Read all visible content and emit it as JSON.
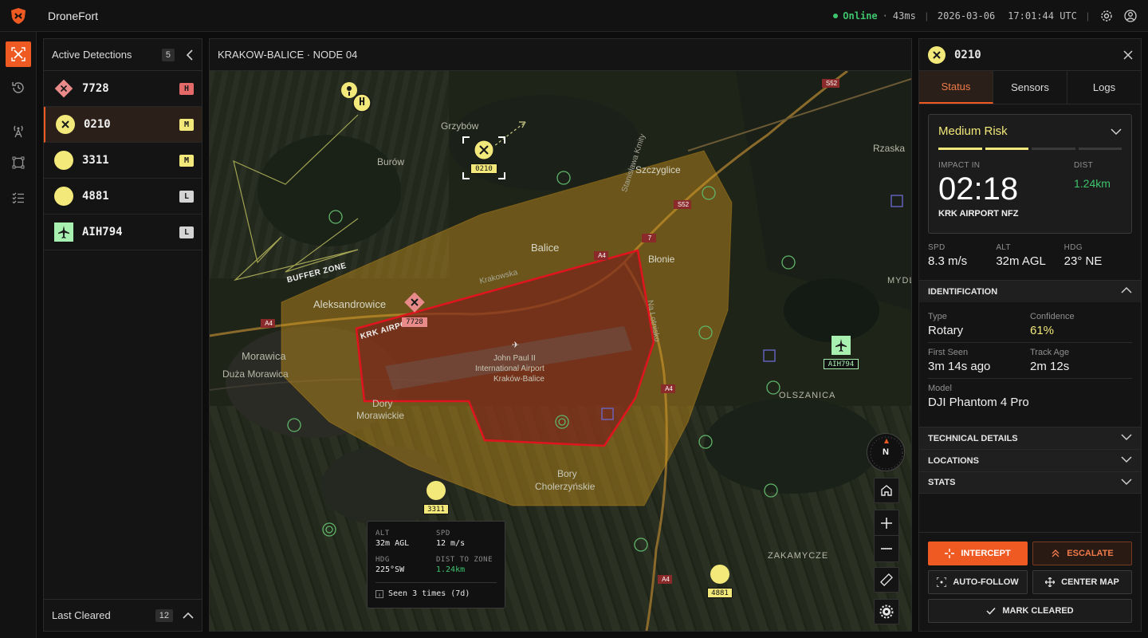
{
  "app": {
    "name": "DroneFort"
  },
  "status": {
    "connection": "Online",
    "latency": "43ms",
    "date": "2026-03-06",
    "time": "17:01:44 UTC"
  },
  "rail": {
    "icons": [
      "drone-target-icon",
      "history-icon",
      "radar-icon",
      "zone-icon",
      "checklist-icon"
    ]
  },
  "detections": {
    "title": "Active Detections",
    "count": "5",
    "items": [
      {
        "id": "7728",
        "risk": "H",
        "kind": "hostile"
      },
      {
        "id": "0210",
        "risk": "M",
        "kind": "unknown"
      },
      {
        "id": "3311",
        "risk": "M",
        "kind": "drone"
      },
      {
        "id": "4881",
        "risk": "L",
        "kind": "drone"
      },
      {
        "id": "AIH794",
        "risk": "L",
        "kind": "aircraft"
      }
    ],
    "footer_label": "Last Cleared",
    "footer_count": "12"
  },
  "map": {
    "title": "KRAKOW-BALICE · NODE 04",
    "labels": {
      "grzybow": "Grzybów",
      "burow": "Burów",
      "szczyglice": "Szczyglice",
      "rzaska": "Rzaska",
      "balice": "Balice",
      "btonie": "Błonie",
      "aleksandrowice": "Aleksandrowice",
      "morawica": "Morawica",
      "duza": "Duża Morawica",
      "dory": "Dory",
      "morawickie": "Morawickie",
      "olszanica": "OLSZANICA",
      "zakamycze": "ZAKAMYCZE",
      "mydl": "MYDL",
      "bory": "Bory",
      "cholerzynskie": "Cholerzyńskie",
      "airport1": "John Paul II",
      "airport2": "International Airport",
      "airport3": "Kraków-Balice",
      "krakowska": "Krakowska",
      "nalotnisko": "Na Lotnisko",
      "stanislawa": "Stanisława Kmity",
      "buffer": "BUFFER ZONE",
      "krkairport": "KRK AIRPORT",
      "a4a": "A4",
      "a4b": "A4",
      "a4c": "A4",
      "a4d": "A4",
      "r7": "7",
      "s52a": "S52",
      "s52b": "S52"
    },
    "markers": {
      "m7728": "7728",
      "m0210": "0210",
      "m3311": "3311",
      "m4881": "4881",
      "maih": "AIH794",
      "home": "H"
    },
    "compass": "N",
    "tooltip": {
      "alt_label": "ALT",
      "alt": "32m AGL",
      "spd_label": "SPD",
      "spd": "12 m/s",
      "hdg_label": "HDG",
      "hdg": "225°SW",
      "dist_label": "DIST TO ZONE",
      "dist": "1.24km",
      "seen": "Seen 3 times (7d)"
    }
  },
  "detail": {
    "id": "0210",
    "tabs": [
      "Status",
      "Sensors",
      "Logs"
    ],
    "risk": {
      "label": "Medium Risk",
      "level": 2,
      "of": 4,
      "impact_label": "IMPACT IN",
      "impact": "02:18",
      "dist_label": "DIST",
      "dist": "1.24km",
      "zone": "KRK AIRPORT NFZ"
    },
    "spd": {
      "label": "SPD",
      "value": "8.3 m/s"
    },
    "alt": {
      "label": "ALT",
      "value": "32m AGL"
    },
    "hdg": {
      "label": "HDG",
      "value": "23° NE"
    },
    "identification": {
      "title": "IDENTIFICATION",
      "type_label": "Type",
      "type": "Rotary",
      "conf_label": "Confidence",
      "conf": "61%",
      "first_label": "First Seen",
      "first": "3m 14s ago",
      "age_label": "Track Age",
      "age": "2m 12s",
      "model_label": "Model",
      "model": "DJI Phantom 4 Pro"
    },
    "sections": [
      "TECHNICAL DETAILS",
      "LOCATIONS",
      "STATS"
    ],
    "actions": {
      "intercept": "INTERCEPT",
      "escalate": "ESCALATE",
      "autofollow": "AUTO-FOLLOW",
      "center": "CENTER MAP",
      "cleared": "MARK CLEARED"
    }
  },
  "colors": {
    "accent": "#ef5a23",
    "high": "#e46a6a",
    "medium": "#f3e97a",
    "low": "#d4d4d4",
    "online": "#3ec46d",
    "zone": "#e0141e",
    "buffer": "#d49a1c"
  }
}
